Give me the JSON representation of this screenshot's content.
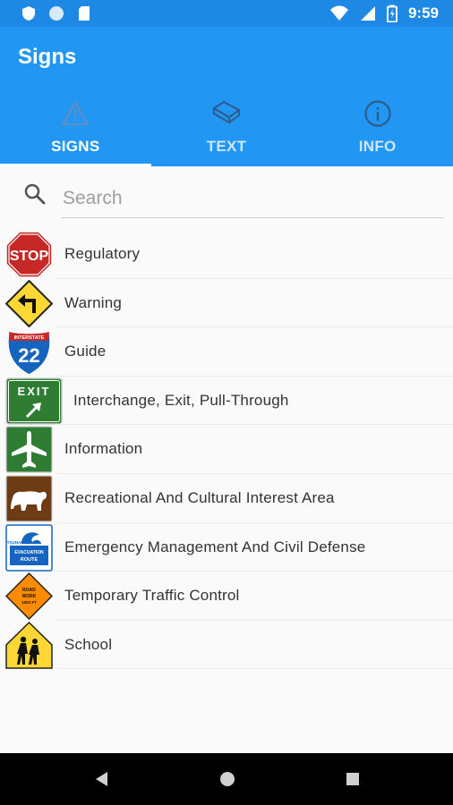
{
  "status_bar": {
    "time": "9:59",
    "icons": [
      "shield-icon",
      "circle-icon",
      "sd-card-icon",
      "wifi-icon",
      "cell-signal-icon",
      "battery-icon"
    ]
  },
  "app_bar": {
    "title": "Signs",
    "background": "#2196f3"
  },
  "tabs": [
    {
      "label": "SIGNS",
      "icon": "warning-icon",
      "active": true
    },
    {
      "label": "TEXT",
      "icon": "book-icon",
      "active": false
    },
    {
      "label": "INFO",
      "icon": "info-icon",
      "active": false
    }
  ],
  "search": {
    "placeholder": "Search",
    "value": ""
  },
  "categories": [
    {
      "label": "Regulatory",
      "sign": "stop-sign-icon",
      "sign_text": "STOP"
    },
    {
      "label": "Warning",
      "sign": "turn-left-warning-sign-icon"
    },
    {
      "label": "Guide",
      "sign": "interstate-shield-icon",
      "sign_text": "22",
      "sign_subtext": "INTERSTATE"
    },
    {
      "label": "Interchange, Exit, Pull-Through",
      "sign": "exit-sign-icon",
      "sign_text": "EXIT"
    },
    {
      "label": "Information",
      "sign": "airport-sign-icon"
    },
    {
      "label": "Recreational And Cultural Interest Area",
      "sign": "bear-sign-icon"
    },
    {
      "label": "Emergency Management And Civil Defense",
      "sign": "tsunami-evacuation-sign-icon",
      "sign_text": "EVACUATION ROUTE",
      "sign_subtext": "TSUNAMI"
    },
    {
      "label": "Temporary Traffic Control",
      "sign": "road-work-sign-icon",
      "sign_text": "ROAD WORK",
      "sign_subtext": "1000 FT"
    },
    {
      "label": "School",
      "sign": "school-crossing-sign-icon"
    }
  ],
  "nav_bar": {
    "buttons": [
      "back-icon",
      "home-icon",
      "recents-icon"
    ]
  }
}
